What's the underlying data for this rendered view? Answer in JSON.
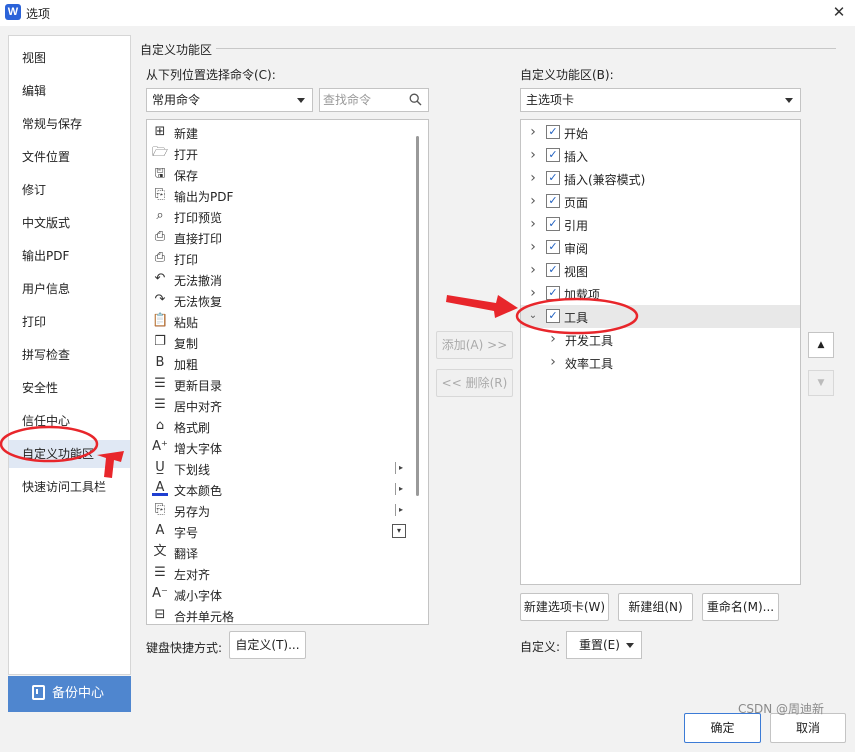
{
  "window": {
    "title": "选项",
    "logo_letter": "W",
    "close_glyph": "✕"
  },
  "nav": {
    "items": [
      {
        "label": "视图"
      },
      {
        "label": "编辑"
      },
      {
        "label": "常规与保存"
      },
      {
        "label": "文件位置"
      },
      {
        "label": "修订"
      },
      {
        "label": "中文版式"
      },
      {
        "label": "输出PDF"
      },
      {
        "label": "用户信息"
      },
      {
        "label": "打印"
      },
      {
        "label": "拼写检查"
      },
      {
        "label": "安全性"
      },
      {
        "label": "信任中心"
      },
      {
        "label": "自定义功能区",
        "selected": true
      },
      {
        "label": "快速访问工具栏"
      }
    ],
    "backup_label": "备份中心"
  },
  "section_title": "自定义功能区",
  "left_panel": {
    "choose_label": "从下列位置选择命令(C):",
    "source_combo_value": "常用命令",
    "search_placeholder": "查找命令",
    "commands": [
      {
        "label": "新建",
        "icon": "new-doc-icon",
        "glyph": "⊞"
      },
      {
        "label": "打开",
        "icon": "folder-open-icon",
        "glyph": "🗁"
      },
      {
        "label": "保存",
        "icon": "save-icon",
        "glyph": "🖫"
      },
      {
        "label": "输出为PDF",
        "icon": "pdf-export-icon",
        "glyph": "⎘"
      },
      {
        "label": "打印预览",
        "icon": "print-preview-icon",
        "glyph": "⌕"
      },
      {
        "label": "直接打印",
        "icon": "direct-print-icon",
        "glyph": "⎙"
      },
      {
        "label": "打印",
        "icon": "print-icon",
        "glyph": "⎙"
      },
      {
        "label": "无法撤消",
        "icon": "undo-icon",
        "glyph": "↶"
      },
      {
        "label": "无法恢复",
        "icon": "redo-icon",
        "glyph": "↷"
      },
      {
        "label": "粘贴",
        "icon": "paste-icon",
        "glyph": "📋"
      },
      {
        "label": "复制",
        "icon": "copy-icon",
        "glyph": "❐"
      },
      {
        "label": "加粗",
        "icon": "bold-icon",
        "glyph": "B"
      },
      {
        "label": "更新目录",
        "icon": "update-toc-icon",
        "glyph": "☰"
      },
      {
        "label": "居中对齐",
        "icon": "align-center-icon",
        "glyph": "☰"
      },
      {
        "label": "格式刷",
        "icon": "format-painter-icon",
        "glyph": "⌂"
      },
      {
        "label": "增大字体",
        "icon": "font-grow-icon",
        "glyph": "A⁺"
      },
      {
        "label": "下划线",
        "icon": "underline-icon",
        "glyph": "U̲",
        "submenu": true
      },
      {
        "label": "文本颜色",
        "icon": "font-color-icon",
        "glyph": "A",
        "submenu": true
      },
      {
        "label": "另存为",
        "icon": "save-as-icon",
        "glyph": "⎘",
        "submenu": true
      },
      {
        "label": "字号",
        "icon": "font-size-icon",
        "glyph": "A",
        "submenu_box": true
      },
      {
        "label": "翻译",
        "icon": "translate-icon",
        "glyph": "文"
      },
      {
        "label": "左对齐",
        "icon": "align-left-icon",
        "glyph": "☰"
      },
      {
        "label": "减小字体",
        "icon": "font-shrink-icon",
        "glyph": "A⁻"
      },
      {
        "label": "合并单元格",
        "icon": "merge-cells-icon",
        "glyph": "⊟"
      }
    ],
    "shortcut_label": "键盘快捷方式:",
    "customize_button": "自定义(T)..."
  },
  "middle": {
    "add_button": "添加(A) >>",
    "remove_button": "<< 删除(R)"
  },
  "right_panel": {
    "ribbon_label": "自定义功能区(B):",
    "tab_combo_value": "主选项卡",
    "tree": [
      {
        "label": "开始",
        "checked": true,
        "expanded": false,
        "level": 0
      },
      {
        "label": "插入",
        "checked": true,
        "expanded": false,
        "level": 0
      },
      {
        "label": "插入(兼容模式)",
        "checked": true,
        "expanded": false,
        "level": 0
      },
      {
        "label": "页面",
        "checked": true,
        "expanded": false,
        "level": 0
      },
      {
        "label": "引用",
        "checked": true,
        "expanded": false,
        "level": 0
      },
      {
        "label": "审阅",
        "checked": true,
        "expanded": false,
        "level": 0
      },
      {
        "label": "视图",
        "checked": true,
        "expanded": false,
        "level": 0
      },
      {
        "label": "加载项",
        "checked": true,
        "expanded": false,
        "level": 0
      },
      {
        "label": "工具",
        "checked": true,
        "expanded": true,
        "level": 0,
        "selected": true
      },
      {
        "label": "开发工具",
        "level": 1
      },
      {
        "label": "效率工具",
        "level": 1
      }
    ],
    "new_tab_button": "新建选项卡(W)",
    "new_group_button": "新建组(N)",
    "rename_button": "重命名(M)...",
    "customize_label": "自定义:",
    "reset_combo_value": "重置(E)",
    "move_up_glyph": "▲",
    "move_down_glyph": "▼"
  },
  "footer": {
    "ok_button": "确定",
    "cancel_button": "取消"
  },
  "watermark": "CSDN @周迪新",
  "colors": {
    "accent": "#4f86cf",
    "selected_nav": "#e0e8f4",
    "annotation_red": "#e8262b"
  }
}
